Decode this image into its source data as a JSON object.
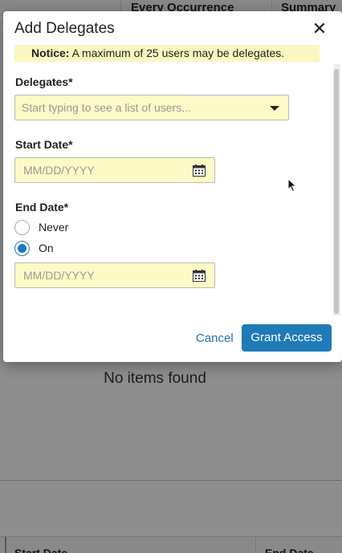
{
  "background": {
    "columns": [
      "Every Occurrence",
      "Summary"
    ],
    "empty_message": "No items found",
    "footer_columns": [
      "Start Date",
      "End Date"
    ]
  },
  "modal": {
    "title": "Add Delegates",
    "close_icon": "close-icon",
    "notice": {
      "label": "Notice:",
      "text": " A maximum of 25 users may be delegates."
    },
    "delegates": {
      "label": "Delegates*",
      "placeholder": "Start typing to see a list of users..."
    },
    "start_date": {
      "label": "Start Date*",
      "placeholder": "MM/DD/YYYY"
    },
    "end_date": {
      "label": "End Date*",
      "options": [
        {
          "label": "Never",
          "checked": false
        },
        {
          "label": "On",
          "checked": true
        }
      ],
      "placeholder": "MM/DD/YYYY"
    },
    "buttons": {
      "cancel": "Cancel",
      "grant": "Grant Access"
    }
  },
  "colors": {
    "accent": "#1f7ab8",
    "field_bg": "#fdfac6",
    "notice_bg": "#fbf7c0"
  }
}
